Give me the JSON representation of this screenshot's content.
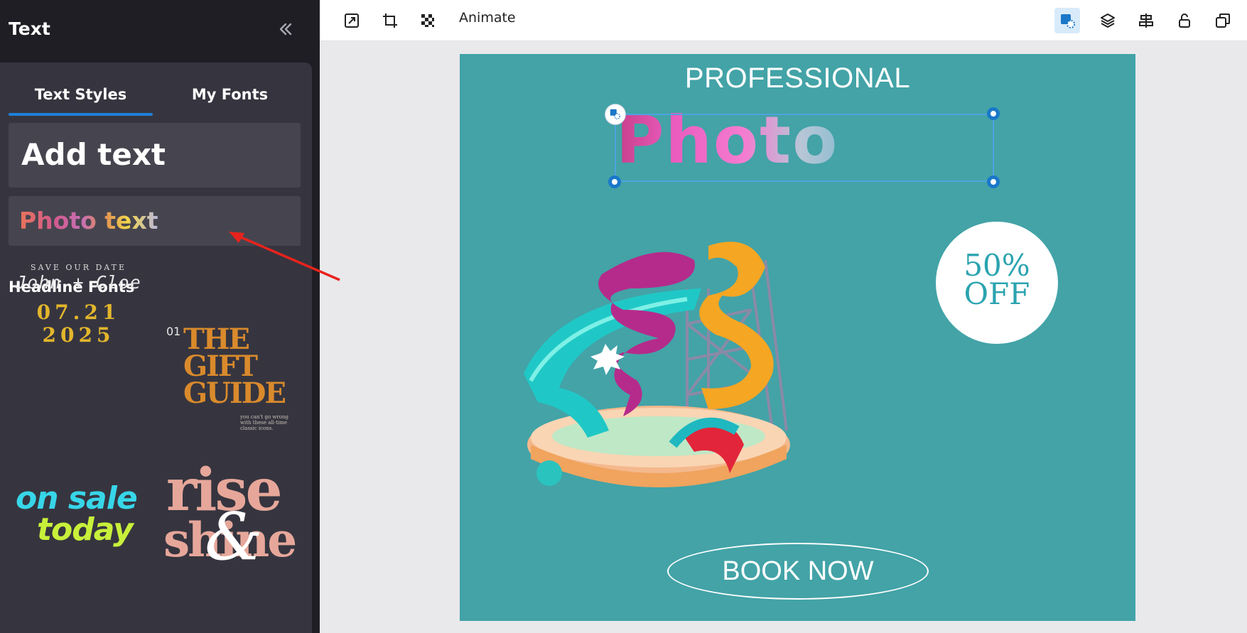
{
  "sidebar": {
    "title": "Text",
    "tabs": [
      {
        "label": "Text Styles",
        "active": true
      },
      {
        "label": "My Fonts",
        "active": false
      }
    ],
    "styles": {
      "add_text": "Add text",
      "photo_text": "Photo text"
    },
    "section_title": "Headline Fonts",
    "font_tiles": {
      "john": {
        "top": "SAVE OUR DATE",
        "names": "John + Cloe",
        "date1": "07.21",
        "date2": "2025"
      },
      "gift": {
        "num": "01",
        "line1": "THE",
        "line2": "GIFT",
        "line3": "GUIDE",
        "small": "you can't go wrong with these all-time classic icons."
      },
      "sale": {
        "line1": "on sale",
        "line2": "today"
      },
      "rise": {
        "line1": "rise",
        "amp": "&",
        "line2": "shine"
      }
    }
  },
  "toolbar": {
    "animate_label": "Animate",
    "icons": [
      "magic-resize-icon",
      "crop-icon",
      "transparency-icon",
      "photo-fill-icon",
      "layers-icon",
      "align-icon",
      "lock-icon",
      "duplicate-icon"
    ]
  },
  "design": {
    "headline": "PROFESSIONAL",
    "photo_text": "Photo text",
    "discount_line1": "50%",
    "discount_line2": "OFF",
    "button": "BOOK NOW",
    "background_color": "#43a3a7"
  }
}
